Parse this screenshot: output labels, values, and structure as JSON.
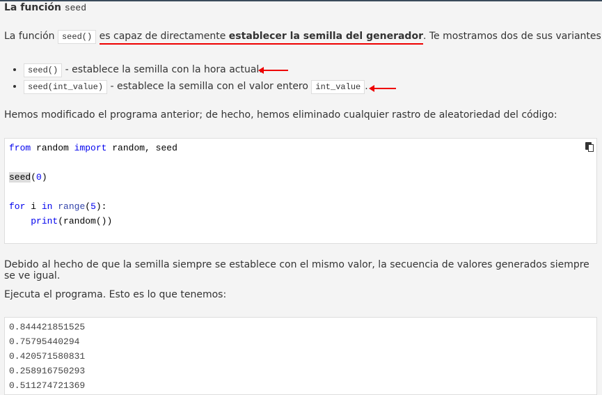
{
  "heading": {
    "text": "La función",
    "code": "seed"
  },
  "intro": {
    "prefix": "La función",
    "code": "seed()",
    "underlined": "es capaz de directamente",
    "bold": "establecer la semilla del generador",
    "suffix": ". Te mostramos dos de sus variantes:"
  },
  "variants": [
    {
      "code": "seed()",
      "text": "- establece la semilla con la hora actual."
    },
    {
      "code": "seed(int_value)",
      "text": "- establece la semilla con el valor entero",
      "code2": "int_value",
      "end": "."
    }
  ],
  "para2": "Hemos modificado el programa anterior; de hecho, hemos eliminado cualquier rastro de aleatoriedad del código:",
  "code": {
    "l1": {
      "from": "from",
      "a": " random ",
      "import": "import",
      "b": " random, seed"
    },
    "l2": {
      "fn": "seed",
      "open": "(",
      "num": "0",
      "close": ")"
    },
    "l3": {
      "for": "for",
      "a": " i ",
      "in": "in",
      "sp": " ",
      "range": "range",
      "open": "(",
      "num": "5",
      "close": "):"
    },
    "l4": {
      "indent": "    ",
      "print": "print",
      "rest": "(random())"
    }
  },
  "para3": "Debido al hecho de que la semilla siempre se establece con el mismo valor, la secuencia de valores generados siempre se ve igual.",
  "para4": "Ejecuta el programa. Esto es lo que tenemos:",
  "output": [
    "0.844421851525",
    "0.75795440294",
    "0.420571580831",
    "0.258916750293",
    "0.511274721369"
  ],
  "accent": "#e00000"
}
